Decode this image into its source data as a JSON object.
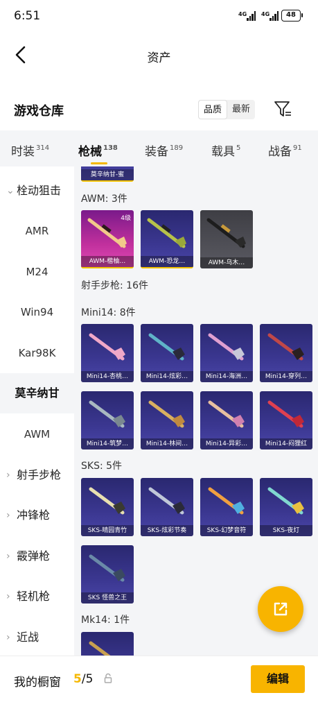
{
  "status_bar": {
    "time": "6:51",
    "signal1": "4G",
    "signal2": "4G",
    "battery": "48"
  },
  "header": {
    "title": "资产"
  },
  "warehouse": {
    "title": "游戏仓库",
    "sort_quality": "品质",
    "sort_newest": "最新"
  },
  "tabs": [
    {
      "label": "时装",
      "count": "314"
    },
    {
      "label": "枪械",
      "count": "138"
    },
    {
      "label": "装备",
      "count": "189"
    },
    {
      "label": "载具",
      "count": "5"
    },
    {
      "label": "战备",
      "count": "91"
    }
  ],
  "sidebar": {
    "category_bolt": "栓动狙击",
    "items": [
      "AMR",
      "M24",
      "Win94",
      "Kar98K"
    ],
    "selected": "莫辛纳甘",
    "sub_selected": "AWM",
    "cat_marksman": "射手步枪",
    "cat_smg": "冲锋枪",
    "cat_shotgun": "霰弹枪",
    "cat_lmg": "轻机枪",
    "cat_melee": "近战"
  },
  "content": {
    "partial_card": "莫辛纳甘-蜜",
    "awm_header": "AWM: 3件",
    "awm_cards": [
      "AWM-楷柚…",
      "AWM-恐龙…",
      "AWM-乌木…"
    ],
    "awm_level": "4级",
    "marksman_header": "射手步枪: 16件",
    "mini14_header": "Mini14: 8件",
    "mini14_cards": [
      "Mini14-杏桃…",
      "Mini14-炫彩…",
      "Mini14-海洲…",
      "Mini14-穿列…",
      "Mini14-筑梦…",
      "Mini14-林间…",
      "Mini14-异彩…",
      "Mini14-闷狸红"
    ],
    "sks_header": "SKS: 5件",
    "sks_cards": [
      "SKS-晴园青竹",
      "SKS-炫彩节奏",
      "SKS-幻梦音符",
      "SKS-夜灯",
      "SKS 怪兽之王"
    ],
    "mk14_header": "Mk14: 1件"
  },
  "bottom": {
    "label": "我的橱窗",
    "current": "5",
    "total": "/5",
    "edit": "编辑"
  },
  "colors": {
    "accent": "#f8b400",
    "card_blue": "#3b3791",
    "card_pink": "#c1309d",
    "card_gray": "#5a5a62"
  }
}
